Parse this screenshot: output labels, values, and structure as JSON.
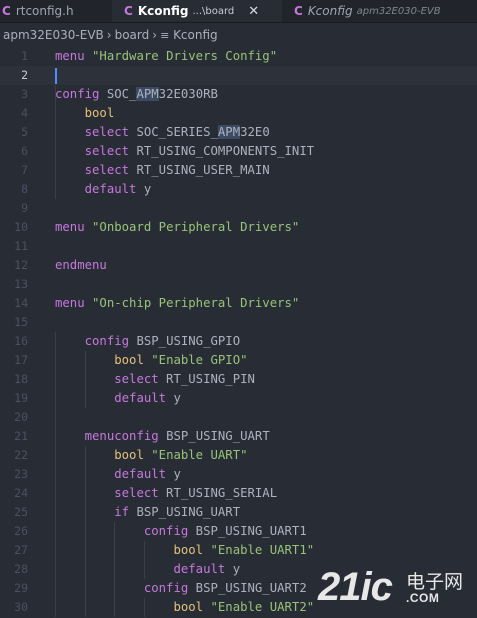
{
  "tabs": [
    {
      "icon": "C",
      "label": "rtconfig.h",
      "desc": ""
    },
    {
      "icon": "C",
      "label": "Kconfig",
      "desc": "...\\board",
      "close": "✕"
    },
    {
      "icon": "C",
      "label": "Kconfig",
      "desc": "apm32E030-EVB"
    }
  ],
  "breadcrumb": {
    "items": [
      "apm32E030-EVB",
      "board",
      "Kconfig"
    ],
    "separator": "›"
  },
  "editor": {
    "current_line": 2,
    "highlight_term": "APM",
    "lines": [
      {
        "n": "1",
        "tokens": [
          [
            "kw",
            "menu"
          ],
          [
            "id",
            " "
          ],
          [
            "str",
            "\"Hardware Drivers Config\""
          ]
        ]
      },
      {
        "n": "2",
        "tokens": []
      },
      {
        "n": "3",
        "tokens": [
          [
            "kw",
            "config"
          ],
          [
            "id",
            " SOC_"
          ],
          [
            "hl",
            "APM"
          ],
          [
            "id",
            "32E030RB"
          ]
        ]
      },
      {
        "n": "4",
        "tokens": [
          [
            "id",
            "    "
          ],
          [
            "ty",
            "bool"
          ]
        ]
      },
      {
        "n": "5",
        "tokens": [
          [
            "id",
            "    "
          ],
          [
            "kw",
            "select"
          ],
          [
            "id",
            " SOC_SERIES_"
          ],
          [
            "hl",
            "APM"
          ],
          [
            "id",
            "32E0"
          ]
        ]
      },
      {
        "n": "6",
        "tokens": [
          [
            "id",
            "    "
          ],
          [
            "kw",
            "select"
          ],
          [
            "id",
            " RT_USING_COMPONENTS_INIT"
          ]
        ]
      },
      {
        "n": "7",
        "tokens": [
          [
            "id",
            "    "
          ],
          [
            "kw",
            "select"
          ],
          [
            "id",
            " RT_USING_USER_MAIN"
          ]
        ]
      },
      {
        "n": "8",
        "tokens": [
          [
            "id",
            "    "
          ],
          [
            "kw",
            "default"
          ],
          [
            "id",
            " y"
          ]
        ]
      },
      {
        "n": "9",
        "tokens": []
      },
      {
        "n": "10",
        "tokens": [
          [
            "kw",
            "menu"
          ],
          [
            "id",
            " "
          ],
          [
            "str",
            "\"Onboard Peripheral Drivers\""
          ]
        ]
      },
      {
        "n": "11",
        "tokens": []
      },
      {
        "n": "12",
        "tokens": [
          [
            "kw",
            "endmenu"
          ]
        ]
      },
      {
        "n": "13",
        "tokens": []
      },
      {
        "n": "14",
        "tokens": [
          [
            "kw",
            "menu"
          ],
          [
            "id",
            " "
          ],
          [
            "str",
            "\"On-chip Peripheral Drivers\""
          ]
        ]
      },
      {
        "n": "15",
        "tokens": []
      },
      {
        "n": "16",
        "tokens": [
          [
            "id",
            "    "
          ],
          [
            "kw",
            "config"
          ],
          [
            "id",
            " BSP_USING_GPIO"
          ]
        ]
      },
      {
        "n": "17",
        "tokens": [
          [
            "id",
            "        "
          ],
          [
            "ty",
            "bool"
          ],
          [
            "id",
            " "
          ],
          [
            "str",
            "\"Enable GPIO\""
          ]
        ]
      },
      {
        "n": "18",
        "tokens": [
          [
            "id",
            "        "
          ],
          [
            "kw",
            "select"
          ],
          [
            "id",
            " RT_USING_PIN"
          ]
        ]
      },
      {
        "n": "19",
        "tokens": [
          [
            "id",
            "        "
          ],
          [
            "kw",
            "default"
          ],
          [
            "id",
            " y"
          ]
        ]
      },
      {
        "n": "20",
        "tokens": []
      },
      {
        "n": "21",
        "tokens": [
          [
            "id",
            "    "
          ],
          [
            "kw",
            "menuconfig"
          ],
          [
            "id",
            " BSP_USING_UART"
          ]
        ]
      },
      {
        "n": "22",
        "tokens": [
          [
            "id",
            "        "
          ],
          [
            "ty",
            "bool"
          ],
          [
            "id",
            " "
          ],
          [
            "str",
            "\"Enable UART\""
          ]
        ]
      },
      {
        "n": "23",
        "tokens": [
          [
            "id",
            "        "
          ],
          [
            "kw",
            "default"
          ],
          [
            "id",
            " y"
          ]
        ]
      },
      {
        "n": "24",
        "tokens": [
          [
            "id",
            "        "
          ],
          [
            "kw",
            "select"
          ],
          [
            "id",
            " RT_USING_SERIAL"
          ]
        ]
      },
      {
        "n": "25",
        "tokens": [
          [
            "id",
            "        "
          ],
          [
            "kw",
            "if"
          ],
          [
            "id",
            " BSP_USING_UART"
          ]
        ]
      },
      {
        "n": "26",
        "tokens": [
          [
            "id",
            "            "
          ],
          [
            "kw",
            "config"
          ],
          [
            "id",
            " BSP_USING_UART1"
          ]
        ]
      },
      {
        "n": "27",
        "tokens": [
          [
            "id",
            "                "
          ],
          [
            "ty",
            "bool"
          ],
          [
            "id",
            " "
          ],
          [
            "str",
            "\"Enable UART1\""
          ]
        ]
      },
      {
        "n": "28",
        "tokens": [
          [
            "id",
            "                "
          ],
          [
            "kw",
            "default"
          ],
          [
            "id",
            " y"
          ]
        ]
      },
      {
        "n": "29",
        "tokens": [
          [
            "id",
            "            "
          ],
          [
            "kw",
            "config"
          ],
          [
            "id",
            " BSP_USING_UART2"
          ]
        ]
      },
      {
        "n": "30",
        "tokens": [
          [
            "id",
            "                "
          ],
          [
            "ty",
            "bool"
          ],
          [
            "id",
            " "
          ],
          [
            "str",
            "\"Enable UART2\""
          ]
        ]
      }
    ]
  },
  "watermark": {
    "logo": "21ic",
    "cn": "电子网",
    "url": ".COM"
  },
  "colors": {
    "keyword": "#c678dd",
    "type": "#e5c07b",
    "string": "#98c379",
    "text": "#abb2bf",
    "background": "#282c34"
  }
}
